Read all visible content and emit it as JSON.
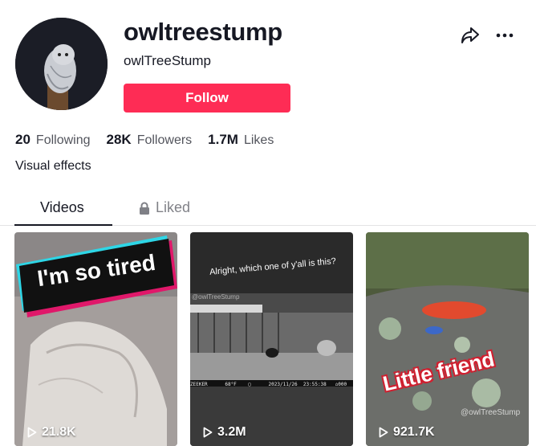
{
  "profile": {
    "username": "owltreestump",
    "nickname": "owlTreeStump",
    "follow_label": "Follow",
    "bio": "Visual effects"
  },
  "stats": {
    "following": {
      "count": "20",
      "label": "Following"
    },
    "followers": {
      "count": "28K",
      "label": "Followers"
    },
    "likes": {
      "count": "1.7M",
      "label": "Likes"
    }
  },
  "actions": {
    "share_icon": "share-icon",
    "more_icon": "more-icon"
  },
  "tabs": [
    {
      "label": "Videos",
      "active": true
    },
    {
      "label": "Liked",
      "active": false,
      "icon": "lock-icon"
    }
  ],
  "videos": [
    {
      "caption": "I'm so tired",
      "views": "21.8K"
    },
    {
      "caption": "Alright, which one of y'all is this?",
      "watermark": "@owlTreeStump",
      "camera_stamp": "ZEEKER      68°F    ▢      2023/11/26  23:55:38   ⌂000",
      "views": "3.2M"
    },
    {
      "caption": "Little friend",
      "watermark": "@owlTreeStump",
      "views": "921.7K"
    }
  ],
  "colors": {
    "accent": "#fe2c55",
    "text": "#161823",
    "muted": "rgba(22,24,35,0.75)"
  }
}
